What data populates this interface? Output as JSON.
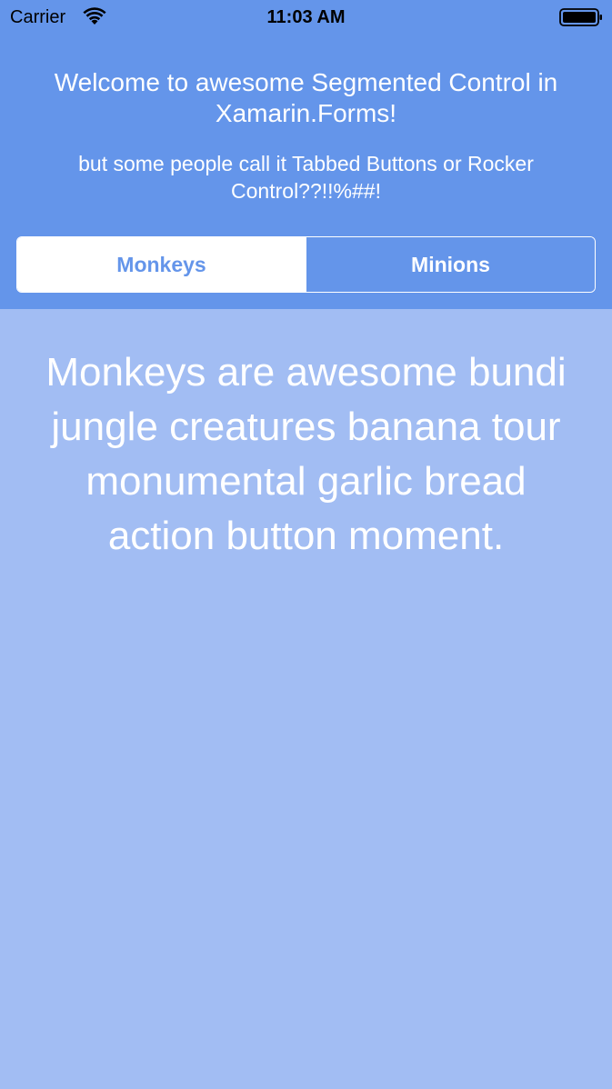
{
  "status_bar": {
    "carrier": "Carrier",
    "time": "11:03 AM",
    "wifi_icon": "wifi-icon",
    "battery_icon": "battery-icon"
  },
  "header": {
    "title": "Welcome to awesome Segmented Control in Xamarin.Forms!",
    "subtitle": "but some people call it Tabbed Buttons or Rocker Control??!!%##!"
  },
  "segmented_control": {
    "selected_index": 0,
    "segments": [
      {
        "label": "Monkeys"
      },
      {
        "label": "Minions"
      }
    ]
  },
  "content": {
    "text": "Monkeys are awesome bundi jungle creatures banana tour monumental garlic bread action button moment."
  },
  "colors": {
    "header_background": "#6495ea",
    "content_background": "#a2bdf3",
    "text": "#ffffff"
  }
}
